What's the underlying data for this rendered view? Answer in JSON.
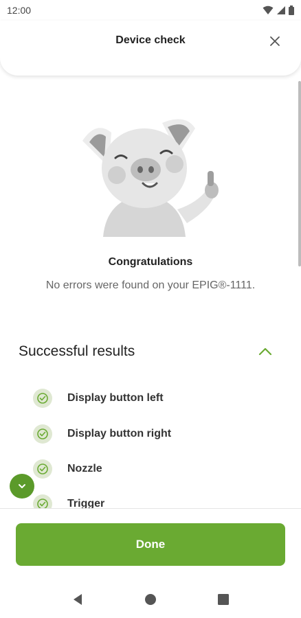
{
  "status_bar": {
    "time": "12:00"
  },
  "header": {
    "title": "Device check"
  },
  "summary": {
    "title": "Congratulations",
    "message": "No errors were found on your EPIG®-1111."
  },
  "results_section": {
    "title": "Successful results",
    "items": [
      {
        "label": "Display button left"
      },
      {
        "label": "Display button right"
      },
      {
        "label": "Nozzle"
      },
      {
        "label": "Trigger"
      }
    ]
  },
  "footer": {
    "done_label": "Done"
  },
  "colors": {
    "accent": "#6aaa32",
    "fab": "#5b9a2a",
    "check_bg": "#dfe8d2"
  },
  "icons": [
    "wifi-icon",
    "signal-icon",
    "battery-icon",
    "close-icon",
    "chevron-up-icon",
    "check-circle-icon",
    "chevron-down-icon",
    "back-icon",
    "home-icon",
    "recents-icon"
  ]
}
